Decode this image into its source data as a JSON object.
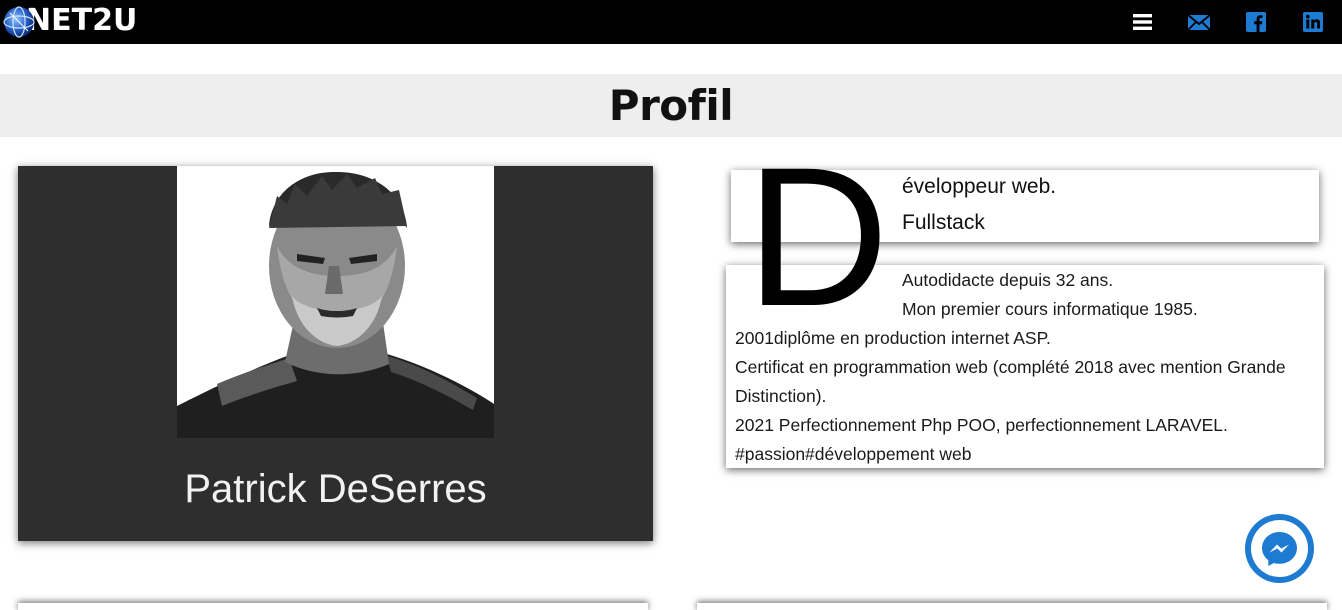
{
  "header": {
    "logo_text": "NET2U",
    "icons": [
      "menu-icon",
      "mail-icon",
      "facebook-icon",
      "linkedin-icon"
    ],
    "icon_color": "#1e7bd2",
    "background": "#000000"
  },
  "title": "Profil",
  "profile": {
    "name": "Patrick DeSerres",
    "card_color": "#2e2e2e"
  },
  "headline": {
    "dropcap": "D",
    "line1": "éveloppeur web.",
    "line2": "Fullstack"
  },
  "bio": {
    "lines": [
      "Autodidacte depuis 32 ans.",
      "Mon premier cours informatique 1985.",
      "2001diplôme en production internet ASP.",
      "Certificat en programmation web (complété 2018 avec mention Grande",
      "Distinction).",
      "2021 Perfectionnement Php POO, perfectionnement LARAVEL.",
      "#passion#développement web"
    ]
  },
  "messenger": {
    "icon": "messenger-icon",
    "color": "#1e7bd2"
  }
}
